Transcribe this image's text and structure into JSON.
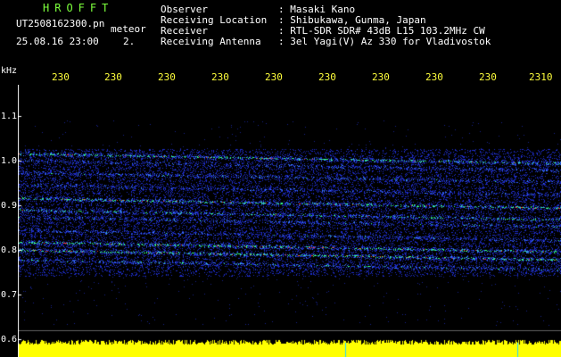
{
  "header": {
    "brand": "HROFFT",
    "filename": "UT2508162300.pn",
    "mode": "meteor",
    "datetime": "25.08.16 23:00",
    "page_indicator": "2.",
    "fields": [
      {
        "label": "Observer",
        "value": ": Masaki Kano"
      },
      {
        "label": "Receiving Location",
        "value": ": Shibukawa, Gunma, Japan"
      },
      {
        "label": "Receiver",
        "value": ": RTL-SDR SDR# 43dB L15 103.2MHz CW"
      },
      {
        "label": "Receiving Antenna",
        "value": ": 3el Yagi(V) Az 330 for Vladivostok"
      }
    ]
  },
  "axis": {
    "unit": "kHz",
    "y_ticks": [
      "1.1",
      "1.0",
      "0.9",
      "0.8",
      "0.7",
      "0.6"
    ],
    "x_ticks": [
      "230",
      "230",
      "230",
      "230",
      "230",
      "230",
      "230",
      "230",
      "230",
      "2310"
    ]
  },
  "colors": {
    "background": "#000000",
    "text": "#ffffff",
    "header_brand": "#7cff3c",
    "time_labels": "#ffff3c",
    "noise": "#1e2cc8",
    "signal": "#33ff88",
    "peak": "#ff3a2a",
    "power_strip": "#ffff00",
    "marker": "#22d8ff"
  }
}
